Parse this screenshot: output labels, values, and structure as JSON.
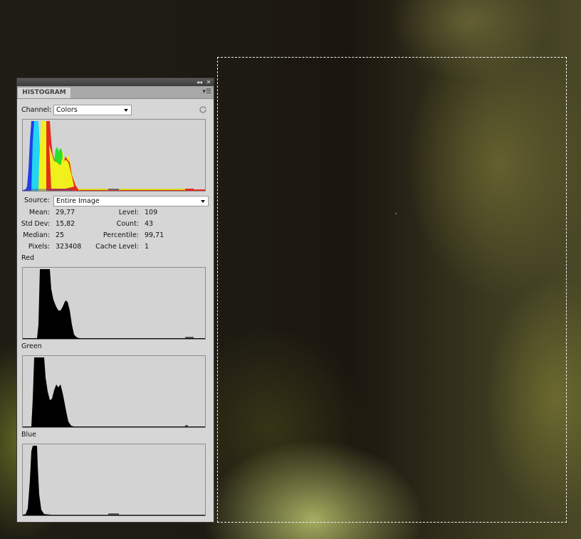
{
  "panel": {
    "tab_label": "HISTOGRAM",
    "collapse_icon": "double-chevron-left-icon",
    "close_icon": "close-icon",
    "menu_icon": "panel-menu-icon",
    "refresh_icon": "refresh-icon",
    "channel_label": "Channel:",
    "channel_value": "Colors",
    "source_label": "Source:",
    "source_value": "Entire Image"
  },
  "stats": {
    "mean_label": "Mean:",
    "mean": "29,77",
    "stddev_label": "Std Dev:",
    "stddev": "15,82",
    "median_label": "Median:",
    "median": "25",
    "pixels_label": "Pixels:",
    "pixels": "323408",
    "level_label": "Level:",
    "level": "109",
    "count_label": "Count:",
    "count": "43",
    "percentile_label": "Percentile:",
    "percentile": "99,71",
    "cache_label": "Cache Level:",
    "cache": "1"
  },
  "channels": {
    "red_label": "Red",
    "green_label": "Green",
    "blue_label": "Blue"
  },
  "colors": {
    "panel_bg": "#d6d6d6",
    "red": "#e2231a",
    "green": "#29e02a",
    "blue": "#1d3df0",
    "cyan": "#22d6f2",
    "yellow": "#f0f01c",
    "histogram_black": "#000000",
    "selection_border": "#f2f2f2"
  }
}
